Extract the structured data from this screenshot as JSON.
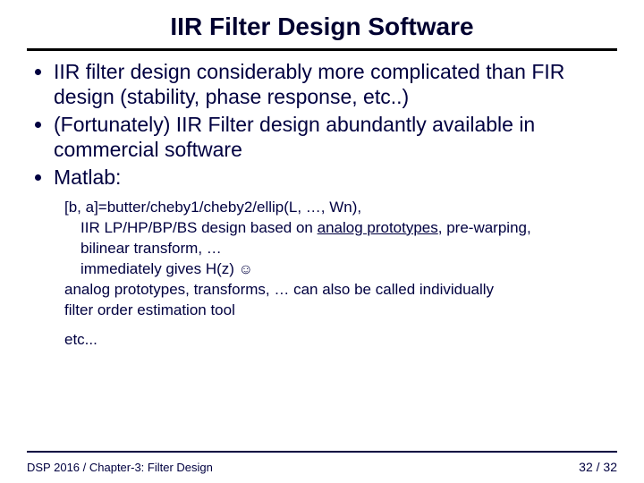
{
  "title": "IIR Filter Design Software",
  "bullets": [
    "IIR filter design considerably more complicated than FIR design (stability, phase response, etc..)",
    "(Fortunately) IIR Filter design abundantly available in commercial software",
    "Matlab:"
  ],
  "code": {
    "l1": "[b, a]=butter/cheby1/cheby2/ellip(L, …, Wn),",
    "l2a": "IIR  LP/HP/BP/BS design based on ",
    "l2u": "analog prototypes",
    "l2b": ", pre-warping,",
    "l3": "bilinear transform, …",
    "l4a": "immediately gives H(z)    ",
    "l4b": "☺",
    "l5": "analog prototypes, transforms, … can also be called individually",
    "l6": "filter order estimation tool",
    "l7": "etc..."
  },
  "footer": {
    "left": "DSP 2016  /  Chapter-3: Filter Design",
    "right": "32 / 32"
  }
}
